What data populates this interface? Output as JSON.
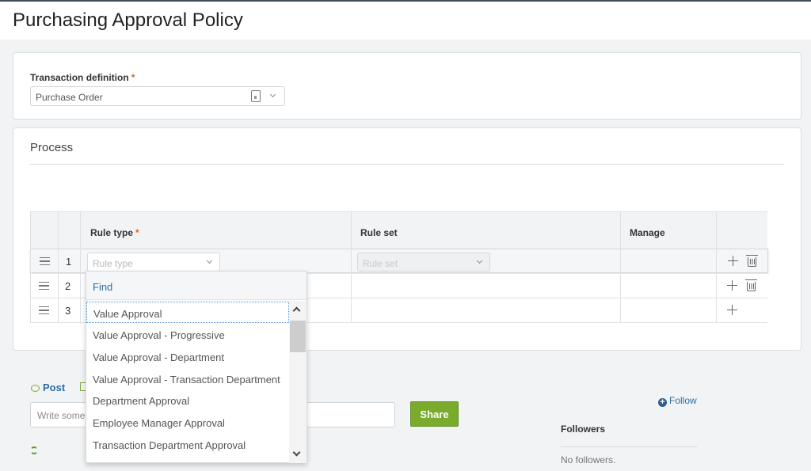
{
  "page": {
    "title": "Purchasing Approval Policy"
  },
  "transaction_definition": {
    "label": "Transaction definition",
    "required_mark": "*",
    "value": "Purchase Order"
  },
  "process": {
    "title": "Process",
    "columns": {
      "rule_type": "Rule type",
      "rule_set": "Rule set",
      "manage": "Manage"
    },
    "required_mark": "*",
    "rows": [
      {
        "num": "1",
        "rule_type_placeholder": "Rule type",
        "rule_set_placeholder": "Rule set"
      },
      {
        "num": "2"
      },
      {
        "num": "3"
      }
    ]
  },
  "dropdown": {
    "find_label": "Find",
    "options": [
      "Value Approval",
      "Value Approval - Progressive",
      "Value Approval - Department",
      "Value Approval - Transaction Department",
      "Department Approval",
      "Employee Manager Approval",
      "Transaction Department Approval"
    ],
    "focused_index": 0
  },
  "social": {
    "post_tab": "Post",
    "input_placeholder": "Write something...",
    "input_visible_text": "Write some",
    "share_label": "Share",
    "follow_label": "Follow",
    "followers_title": "Followers",
    "no_followers": "No followers."
  },
  "colors": {
    "accent_blue": "#2b6ea8",
    "share_green": "#7aab2c",
    "required_orange": "#c56c2d"
  }
}
